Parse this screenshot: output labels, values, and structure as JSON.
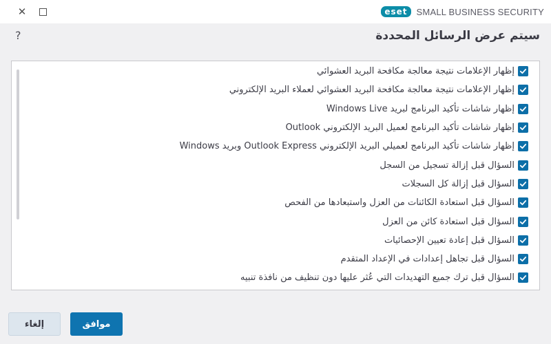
{
  "window": {
    "close_glyph": "✕",
    "brand_logo": "eset",
    "product_name": "SMALL BUSINESS SECURITY"
  },
  "header": {
    "title": "سيتم عرض الرسائل المحددة",
    "help_glyph": "?"
  },
  "options": [
    {
      "label": "إظهار الإعلامات نتيجة معالجة مكافحة البريد العشوائي",
      "checked": true
    },
    {
      "label": "إظهار الإعلامات نتيجة معالجة مكافحة البريد العشوائي لعملاء البريد الإلكتروني",
      "checked": true
    },
    {
      "label": "إظهار شاشات تأكيد البرنامج لبريد Windows Live",
      "checked": true
    },
    {
      "label": "إظهار شاشات تأكيد البرنامج لعميل البريد الإلكتروني Outlook",
      "checked": true
    },
    {
      "label": "إظهار شاشات تأكيد البرنامج لعميلي البريد الإلكتروني Outlook Express وبريد Windows",
      "checked": true
    },
    {
      "label": "السؤال قبل إزالة تسجيل من السجل",
      "checked": true
    },
    {
      "label": "السؤال قبل إزالة كل السجلات",
      "checked": true
    },
    {
      "label": "السؤال قبل استعادة الكائنات من العزل واستبعادها من الفحص",
      "checked": true
    },
    {
      "label": "السؤال قبل استعادة كائن من العزل",
      "checked": true
    },
    {
      "label": "السؤال قبل إعادة تعيين الإحصائيات",
      "checked": true
    },
    {
      "label": "السؤال قبل تجاهل إعدادات في الإعداد المتقدم",
      "checked": true
    },
    {
      "label": "السؤال قبل ترك جميع التهديدات التي عُثر عليها دون تنظيف من نافذة تنبيه",
      "checked": true
    },
    {
      "label": "",
      "checked": true
    }
  ],
  "buttons": {
    "ok_label": "موافق",
    "cancel_label": "إلغاء"
  },
  "colors": {
    "accent": "#0f74b0",
    "checkbox": "#0d6fa8",
    "brand": "#0d8da8"
  }
}
